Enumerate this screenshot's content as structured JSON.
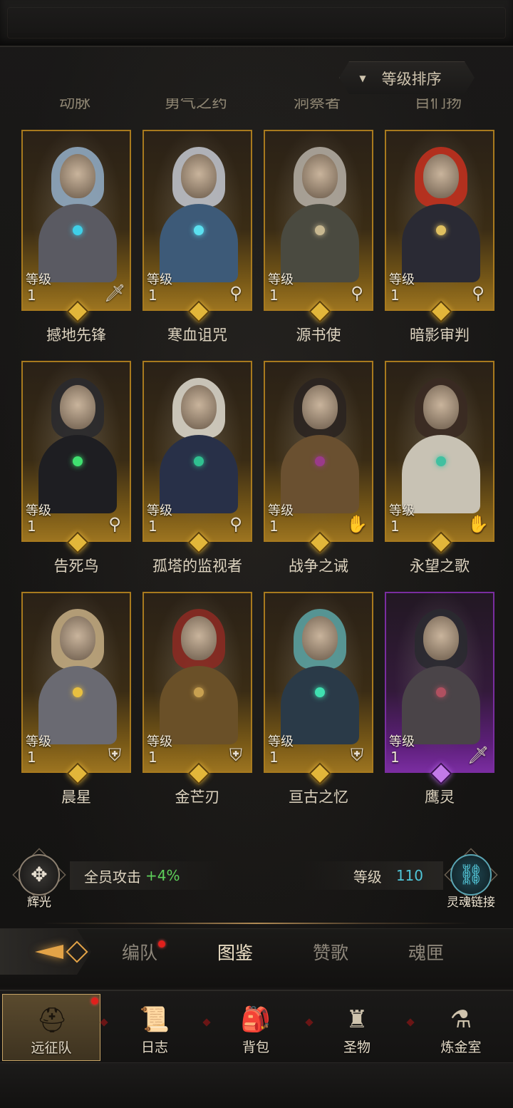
{
  "sort_button": {
    "label": "等级排序"
  },
  "cut_off_names": [
    "动脉",
    "勇气之药",
    "洞察者",
    "目们扬"
  ],
  "level_label": "等级",
  "heroes": [
    {
      "name": "撼地先锋",
      "level": "1",
      "class_icon": "sword-icon",
      "rarity": "gold",
      "hair": "#8fa8c0",
      "outfit": "#5a5a62",
      "gem": "#3fd0e8"
    },
    {
      "name": "寒血诅咒",
      "level": "1",
      "class_icon": "staff-icon",
      "rarity": "gold",
      "hair": "#bcc0c8",
      "outfit": "#3d5a78",
      "gem": "#5be0f0"
    },
    {
      "name": "源书使",
      "level": "1",
      "class_icon": "staff-icon",
      "rarity": "gold",
      "hair": "#b0aaa0",
      "outfit": "#4a4a40",
      "gem": "#c8b890"
    },
    {
      "name": "暗影审判",
      "level": "1",
      "class_icon": "staff-icon",
      "rarity": "gold",
      "hair": "#c0301e",
      "outfit": "#2a2a34",
      "gem": "#e0c060"
    },
    {
      "name": "告死鸟",
      "level": "1",
      "class_icon": "staff-icon",
      "rarity": "gold",
      "hair": "#2a2a2e",
      "outfit": "#1e1e22",
      "gem": "#40e070"
    },
    {
      "name": "孤塔的监视者",
      "level": "1",
      "class_icon": "staff-icon",
      "rarity": "gold",
      "hair": "#d8d4c8",
      "outfit": "#283048",
      "gem": "#30c090"
    },
    {
      "name": "战争之诫",
      "level": "1",
      "class_icon": "hand-icon",
      "rarity": "gold",
      "hair": "#2a2420",
      "outfit": "#6a5030",
      "gem": "#9a3a8a"
    },
    {
      "name": "永望之歌",
      "level": "1",
      "class_icon": "hand-icon",
      "rarity": "gold",
      "hair": "#3a2a22",
      "outfit": "#c8c2b4",
      "gem": "#40c0a0"
    },
    {
      "name": "晨星",
      "level": "1",
      "class_icon": "shield-icon",
      "rarity": "gold",
      "hair": "#c0a880",
      "outfit": "#6a6a72",
      "gem": "#e8c040"
    },
    {
      "name": "金芒刃",
      "level": "1",
      "class_icon": "shield-icon",
      "rarity": "gold",
      "hair": "#8a2a22",
      "outfit": "#6a5028",
      "gem": "#c8a050"
    },
    {
      "name": "亘古之忆",
      "level": "1",
      "class_icon": "shield-icon",
      "rarity": "gold",
      "hair": "#5aa0a0",
      "outfit": "#2a3a48",
      "gem": "#40e0b0"
    },
    {
      "name": "鹰灵",
      "level": "1",
      "class_icon": "sword-icon",
      "rarity": "purple",
      "hair": "#2a2a30",
      "outfit": "#4a4448",
      "gem": "#b05060"
    }
  ],
  "bonus": {
    "emblem_caption": "辉光",
    "buff_label": "全员攻击",
    "buff_value": "+4%",
    "level_label": "等级",
    "level_value": "110",
    "link_caption": "灵魂链接"
  },
  "tabs": [
    {
      "label": "编队",
      "active": false,
      "badge": true
    },
    {
      "label": "图鉴",
      "active": true,
      "badge": false
    },
    {
      "label": "赞歌",
      "active": false,
      "badge": false
    },
    {
      "label": "魂匣",
      "active": false,
      "badge": false
    }
  ],
  "nav": [
    {
      "label": "远征队",
      "icon": "helmet-icon",
      "active": true,
      "badge": true
    },
    {
      "label": "日志",
      "icon": "scroll-icon",
      "active": false,
      "badge": false
    },
    {
      "label": "背包",
      "icon": "backpack-icon",
      "active": false,
      "badge": false
    },
    {
      "label": "圣物",
      "icon": "chalice-icon",
      "active": false,
      "badge": false
    },
    {
      "label": "炼金室",
      "icon": "alchemy-icon",
      "active": false,
      "badge": false
    }
  ],
  "colors": {
    "gold_frame": "#a87a1e",
    "purple_frame": "#7a2da0",
    "buff_green": "#5ed05a",
    "level_cyan": "#4fc6d8",
    "badge_red": "#e0201c"
  }
}
